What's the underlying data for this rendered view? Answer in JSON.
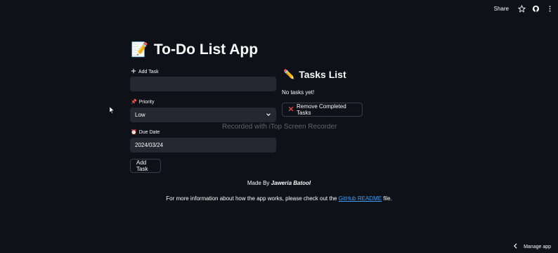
{
  "topbar": {
    "share_label": "Share",
    "icons": [
      "star-icon",
      "github-icon",
      "more-vertical-icon"
    ]
  },
  "header": {
    "emoji": "📝",
    "title": "To-Do List App"
  },
  "form": {
    "add_task_label": "Add Task",
    "task_input_value": "",
    "priority_label": "Priority",
    "priority_selected": "Low",
    "due_date_label": "Due Date",
    "due_date_value": "2024/03/24",
    "submit_label": "Add Task"
  },
  "tasks": {
    "title": "Tasks List",
    "empty_text": "No tasks yet!",
    "remove_completed_label": "Remove Completed Tasks"
  },
  "watermark": "Recorded with iTop Screen Recorder",
  "footer": {
    "made_by_prefix": "Made By",
    "author": "Jaweria Batool",
    "info_prefix": "For more information about how the app works, please check out the",
    "link_text": "GitHub README",
    "info_suffix": "file."
  },
  "manage_app_label": "Manage app",
  "colors": {
    "background": "#0e1117",
    "input_bg": "#262730",
    "link": "#3d9df3",
    "remove_icon": "#ff4b4b"
  }
}
